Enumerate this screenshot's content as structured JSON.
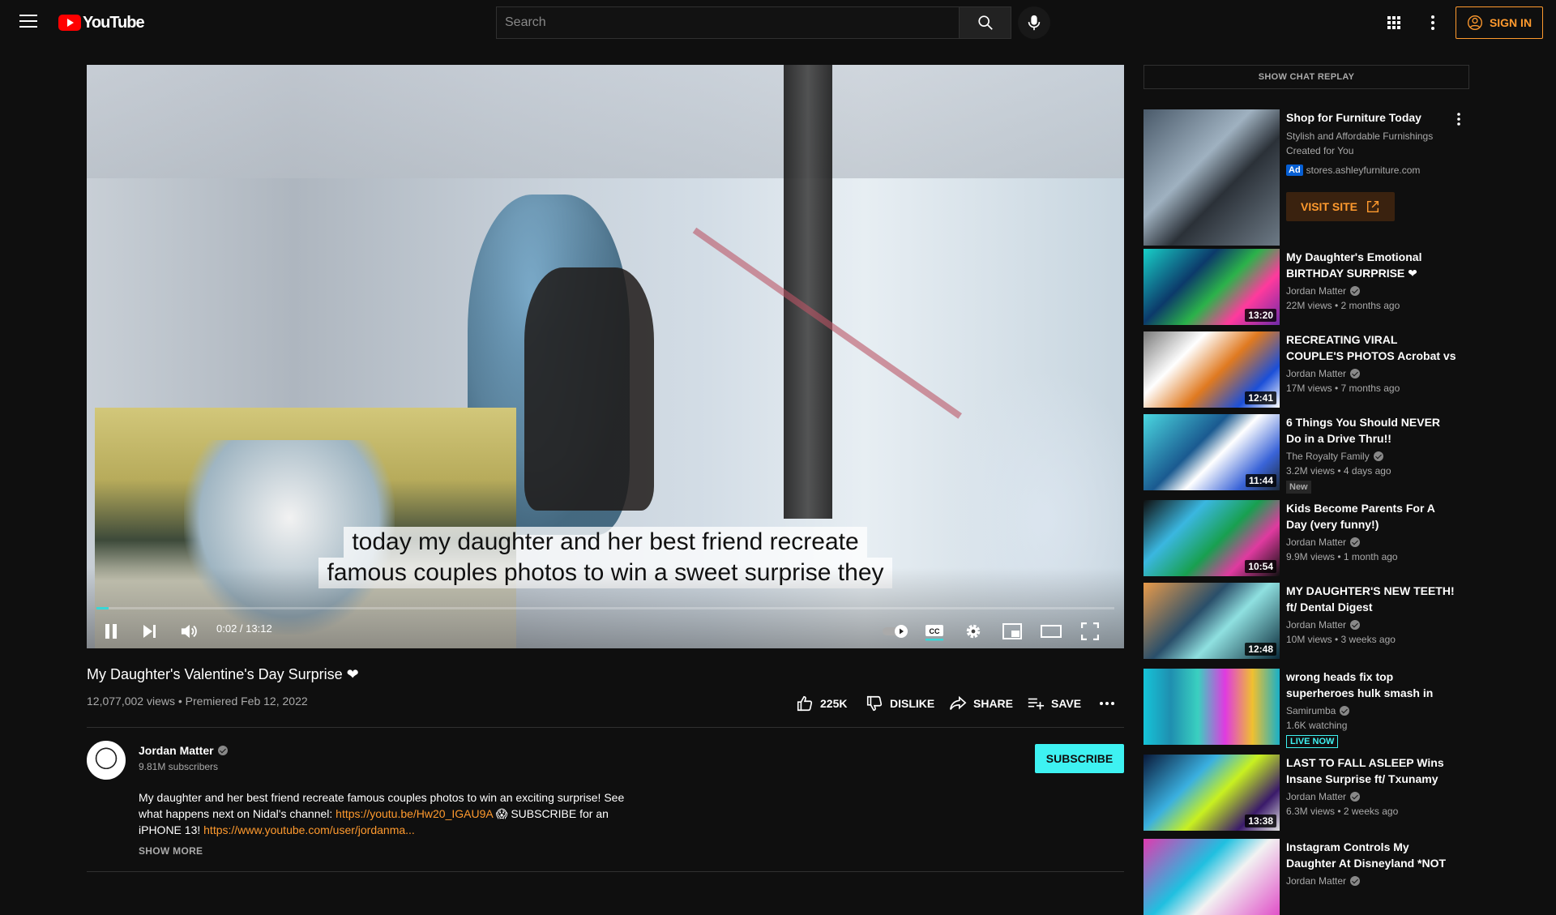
{
  "header": {
    "logo_text": "YouTube",
    "search_placeholder": "Search",
    "sign_in_label": "SIGN IN"
  },
  "player": {
    "caption_line1": "today my daughter and her best friend recreate",
    "caption_line2": "famous couples photos to win a sweet surprise they",
    "time_current": "0:02",
    "time_separator": " / ",
    "time_total": "13:12",
    "progress_fraction": 0.003
  },
  "video": {
    "title": "My Daughter's Valentine's Day Surprise ❤",
    "views": "12,077,002 views",
    "premiered": "Premiered Feb 12, 2022",
    "like_count": "225K",
    "dislike_label": "DISLIKE",
    "share_label": "SHARE",
    "save_label": "SAVE"
  },
  "channel": {
    "name": "Jordan Matter",
    "subscribers": "9.81M subscribers",
    "subscribe_label": "SUBSCRIBE"
  },
  "description": {
    "text1": "My daughter and her best friend recreate famous couples photos to win an exciting surprise! See what happens next on Nidal's channel: ",
    "link1": "https://youtu.be/Hw20_IGAU9A",
    "text2": " 😱 SUBSCRIBE for an iPHONE 13! ",
    "link2": "https://www.youtube.com/user/jordanma...",
    "show_more": "SHOW MORE"
  },
  "sidebar": {
    "chat_replay_label": "SHOW CHAT REPLAY",
    "ad": {
      "title": "Shop for Furniture Today",
      "description": "Stylish and Affordable Furnishings Created for You",
      "badge": "Ad",
      "domain": "stores.ashleyfurniture.com",
      "visit_label": "VISIT SITE"
    },
    "recommendations": [
      {
        "title": "My Daughter's Emotional BIRTHDAY SURPRISE ❤",
        "channel": "Jordan Matter",
        "verified": true,
        "meta": "22M views • 2 months ago",
        "duration": "13:20",
        "badge": ""
      },
      {
        "title": "RECREATING VIRAL COUPLE'S PHOTOS Acrobat vs Gymnast",
        "channel": "Jordan Matter",
        "verified": true,
        "meta": "17M views • 7 months ago",
        "duration": "12:41",
        "badge": ""
      },
      {
        "title": "6 Things You Should NEVER Do in a Drive Thru!!",
        "channel": "The Royalty Family",
        "verified": true,
        "meta": "3.2M views • 4 days ago",
        "duration": "11:44",
        "badge": "New"
      },
      {
        "title": "Kids Become Parents For A Day (very funny!)",
        "channel": "Jordan Matter",
        "verified": true,
        "meta": "9.9M views • 1 month ago",
        "duration": "10:54",
        "badge": ""
      },
      {
        "title": "MY DAUGHTER'S NEW TEETH! ft/ Dental Digest",
        "channel": "Jordan Matter",
        "verified": true,
        "meta": "10M views • 3 weeks ago",
        "duration": "12:48",
        "badge": ""
      },
      {
        "title": "wrong heads fix top superheroes hulk smash in rea...",
        "channel": "Samirumba",
        "verified": true,
        "meta": "1.6K watching",
        "duration": "",
        "badge": "LIVE NOW"
      },
      {
        "title": "LAST TO FALL ASLEEP Wins Insane Surprise ft/ Txunamy",
        "channel": "Jordan Matter",
        "verified": true,
        "meta": "6.3M views • 2 weeks ago",
        "duration": "13:38",
        "badge": ""
      },
      {
        "title": "Instagram Controls My Daughter At Disneyland *NOT ...",
        "channel": "Jordan Matter",
        "verified": true,
        "meta": "",
        "duration": "",
        "badge": ""
      }
    ]
  },
  "colors": {
    "accent": "#ff9a2e",
    "subscribe": "#3ef2f2",
    "progress": "#3ad6d6"
  }
}
